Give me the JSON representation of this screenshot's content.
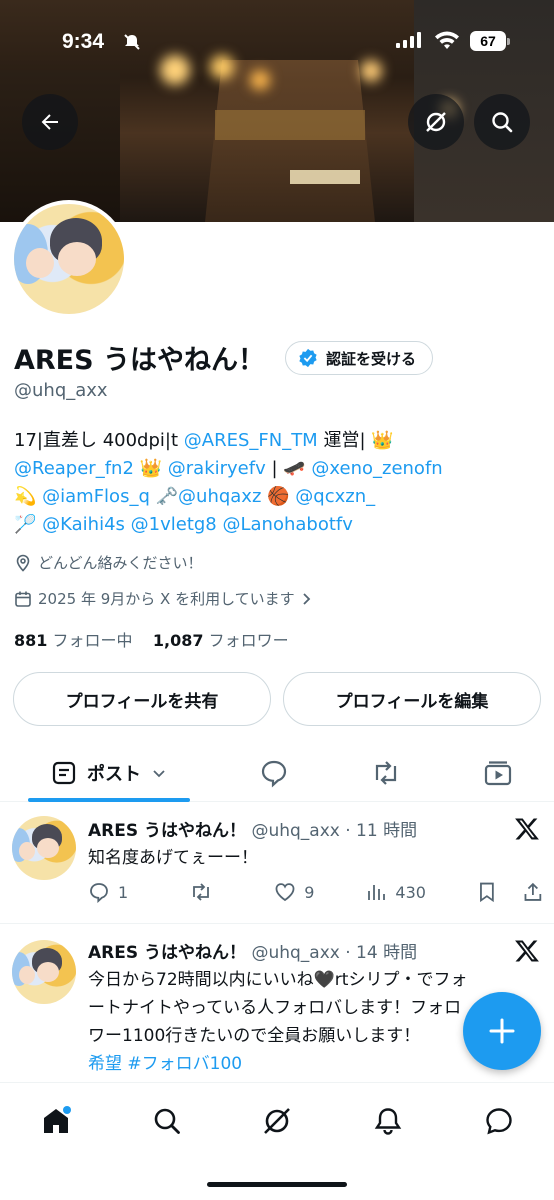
{
  "status_bar": {
    "time": "9:34",
    "battery": "67"
  },
  "profile": {
    "display_name": "ARES うはやねん！",
    "verify_label": "認証を受ける",
    "handle": "@uhq_axx",
    "bio_line1_a": "17|直差し 400dpi|t ",
    "bio_line1_link": "@ARES_FN_TM",
    "bio_line1_b": " 運営| 👑",
    "bio_line2_link1": "@Reaper_fn2",
    "bio_line2_a": " 👑 ",
    "bio_line2_link2": "@rakiryefv",
    "bio_line2_b": " | 🛹 ",
    "bio_line2_link3": "@xeno_zenofn",
    "bio_line3_a": "💫 ",
    "bio_line3_link1": "@iamFlos_q",
    "bio_line3_b": " 🗝️",
    "bio_line3_link2": "@uhqaxz",
    "bio_line3_c": " 🏀 ",
    "bio_line3_link3": "@qcxzn_",
    "bio_line4_a": "🏸 ",
    "bio_line4_link1": "@Kaihi4s",
    "bio_line4_link2": "@1vletg8",
    "bio_line4_link3": "@Lanohabotfv",
    "location": "どんどん絡みください！",
    "joined": "2025 年 9月から X を利用しています",
    "following_count": "881",
    "following_label": "フォロー中",
    "followers_count": "1,087",
    "followers_label": "フォロワー",
    "share_label": "プロフィールを共有",
    "edit_label": "プロフィールを編集"
  },
  "tabs": {
    "posts_label": "ポスト"
  },
  "posts": [
    {
      "name": "ARES うはやねん！",
      "meta": "@uhq_axx · 11 時間",
      "text": "知名度あげてぇーー！",
      "replies": "1",
      "likes": "9",
      "views": "430"
    },
    {
      "name": "ARES うはやねん！",
      "meta": "@uhq_axx · 14 時間",
      "text_line1": "今日から72時間以内にいいね🖤rtシリプ・でフォ",
      "text_line2": "ートナイトやっている人フォロバします！フォロ",
      "text_line3": "ワー1100行きたいので全員お願いします！",
      "hashtags": "希望 #フォロバ100"
    }
  ],
  "colors": {
    "accent": "#1d9bf0",
    "text": "#0f1419",
    "muted": "#536471"
  }
}
